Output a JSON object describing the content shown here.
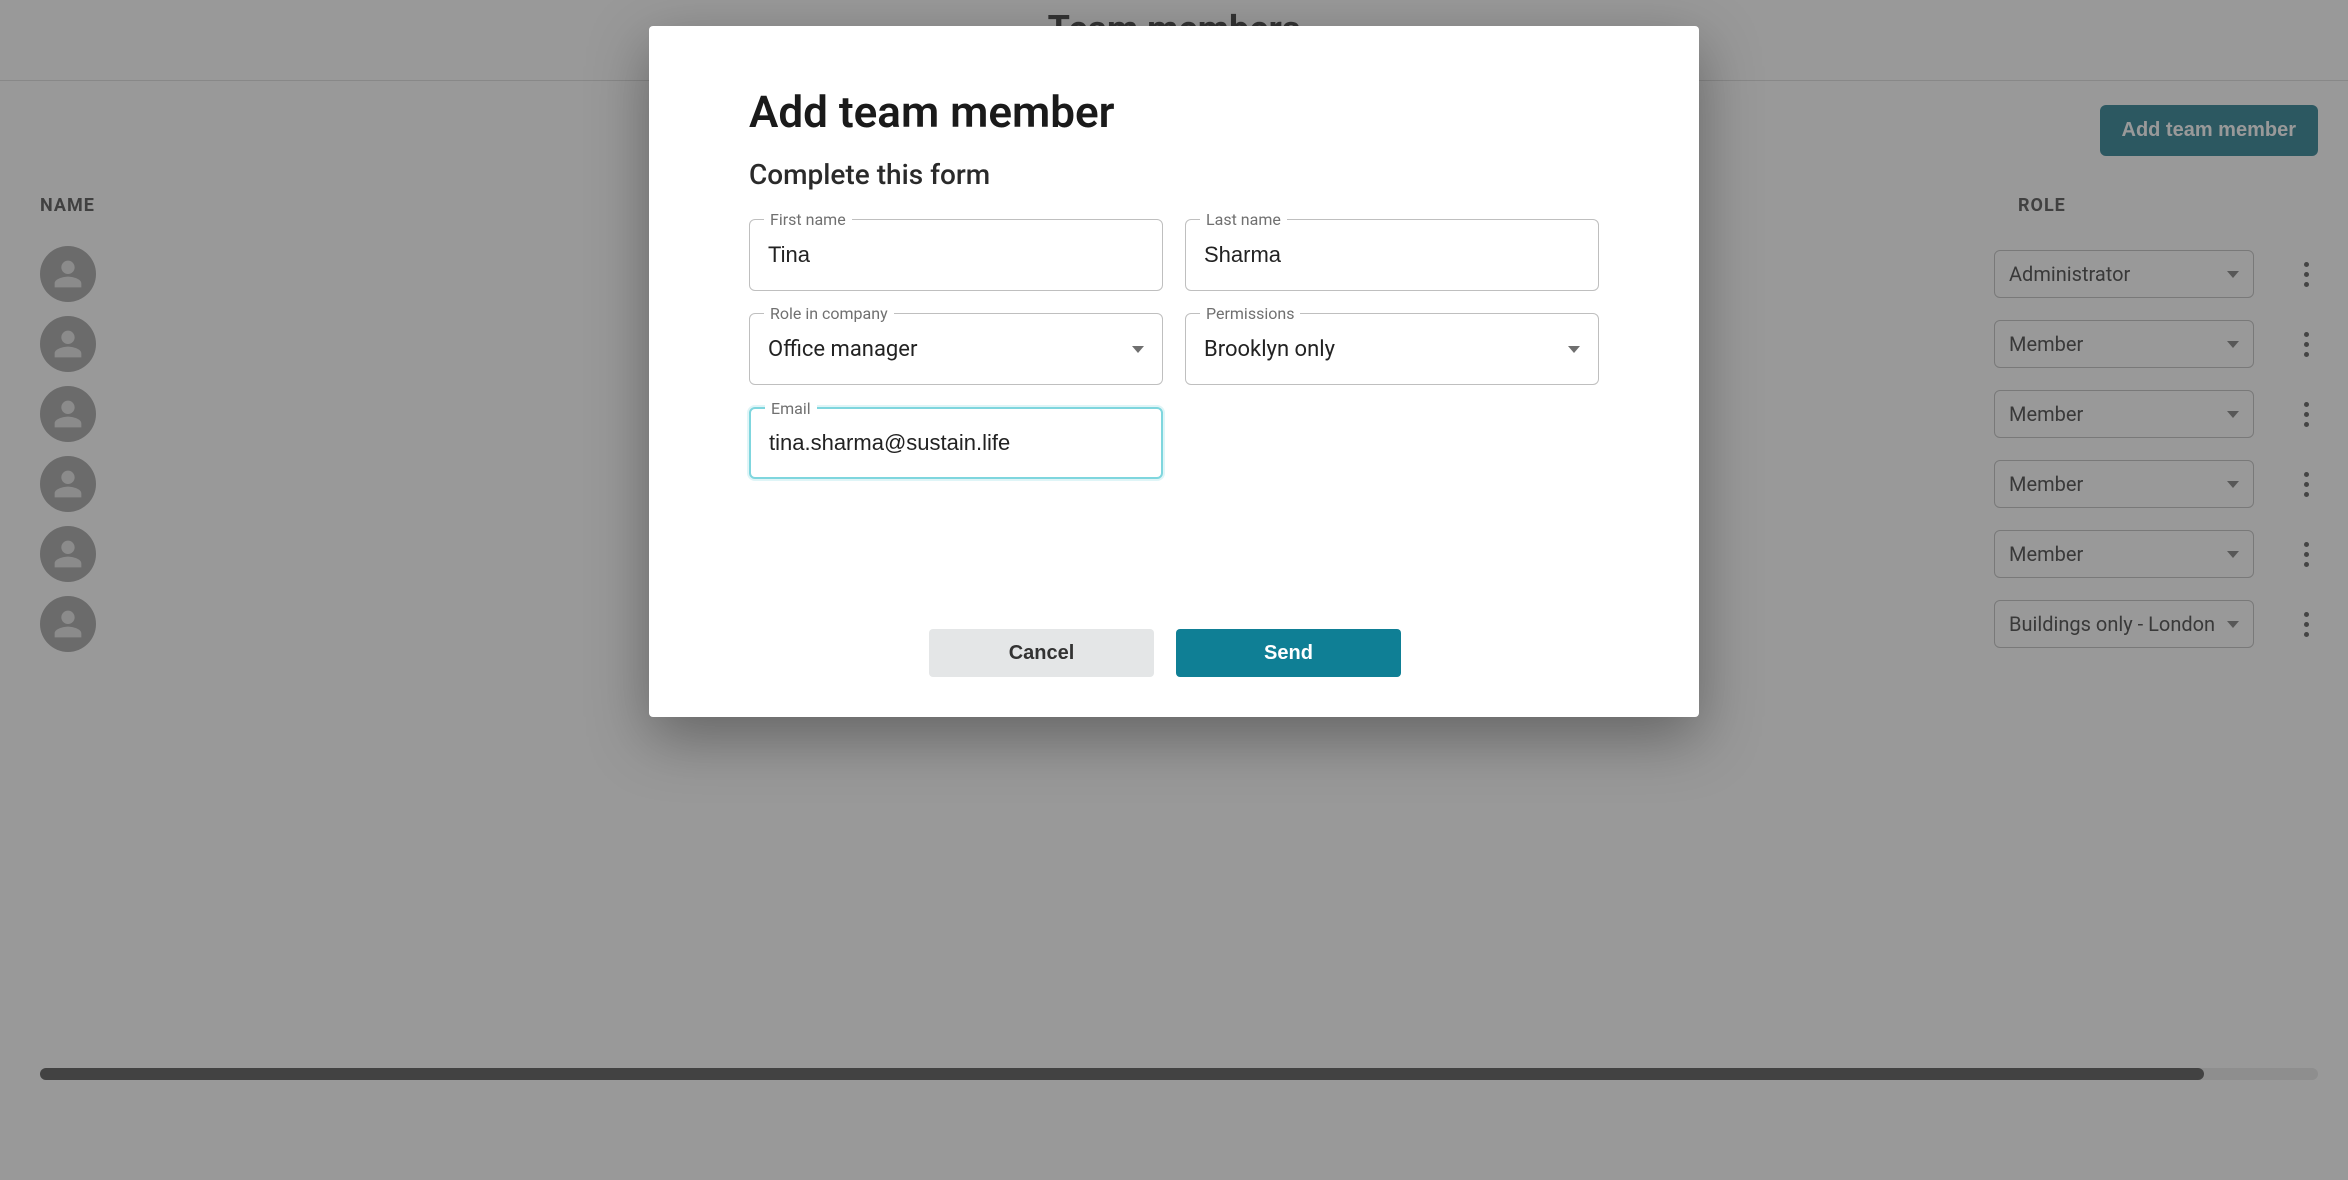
{
  "page": {
    "title": "Team members",
    "add_button": "Add team member",
    "columns": {
      "name": "NAME",
      "role": "ROLE"
    },
    "rows": [
      {
        "role": "Administrator"
      },
      {
        "role": "Member"
      },
      {
        "role": "Member"
      },
      {
        "role": "Member"
      },
      {
        "role": "Member"
      },
      {
        "role": "Buildings only - London"
      }
    ]
  },
  "modal": {
    "title": "Add team member",
    "subtitle": "Complete this form",
    "fields": {
      "first_name": {
        "label": "First name",
        "value": "Tina"
      },
      "last_name": {
        "label": "Last name",
        "value": "Sharma"
      },
      "role": {
        "label": "Role in company",
        "value": "Office manager"
      },
      "permissions": {
        "label": "Permissions",
        "value": "Brooklyn only"
      },
      "email": {
        "label": "Email",
        "value": "tina.sharma@sustain.life"
      }
    },
    "actions": {
      "cancel": "Cancel",
      "send": "Send"
    }
  }
}
